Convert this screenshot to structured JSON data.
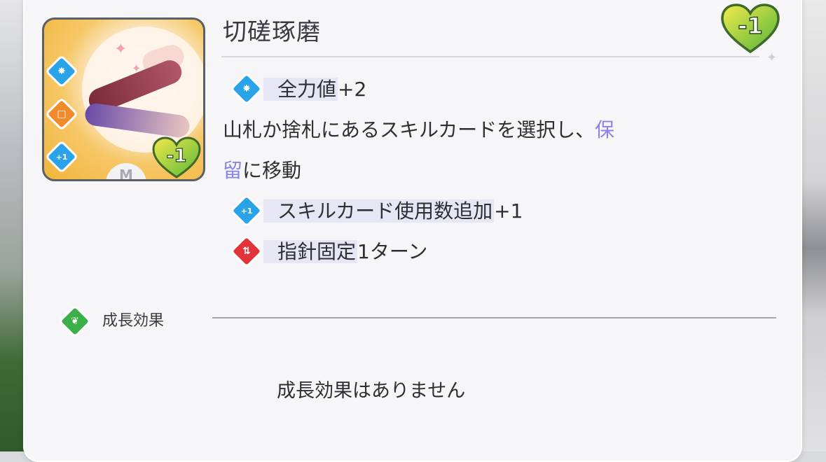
{
  "card": {
    "title": "切磋琢磨",
    "cost": "-1",
    "art_cost": "-1",
    "art_badge": "M",
    "art_icons": [
      "genki-star-icon",
      "concentration-square-icon",
      "plus-one-icon"
    ]
  },
  "effects": {
    "line1_keyword": "全力値",
    "line1_value": "+2",
    "line2_prefix": "山札か捨札にあるスキルカードを選択し、",
    "line2_link1": "保",
    "line3_link2": "留",
    "line3_suffix": "に移動",
    "line4_keyword": "スキルカード使用数追加",
    "line4_value": "+1",
    "line5_keyword": "指針固定",
    "line5_value": "1ターン",
    "icon_plus_one_text": "+1"
  },
  "growth": {
    "label": "成長効果",
    "empty_text": "成長効果はありません"
  },
  "colors": {
    "card_bg": "#f6f6f8",
    "link": "#8a83e6",
    "heart_green": "#6cc447",
    "heart_yellow": "#e6e24a",
    "icon_blue": "#2aa3e8",
    "icon_red": "#e3343c",
    "icon_green": "#3cae4a",
    "highlight": "#e7e6f4"
  }
}
